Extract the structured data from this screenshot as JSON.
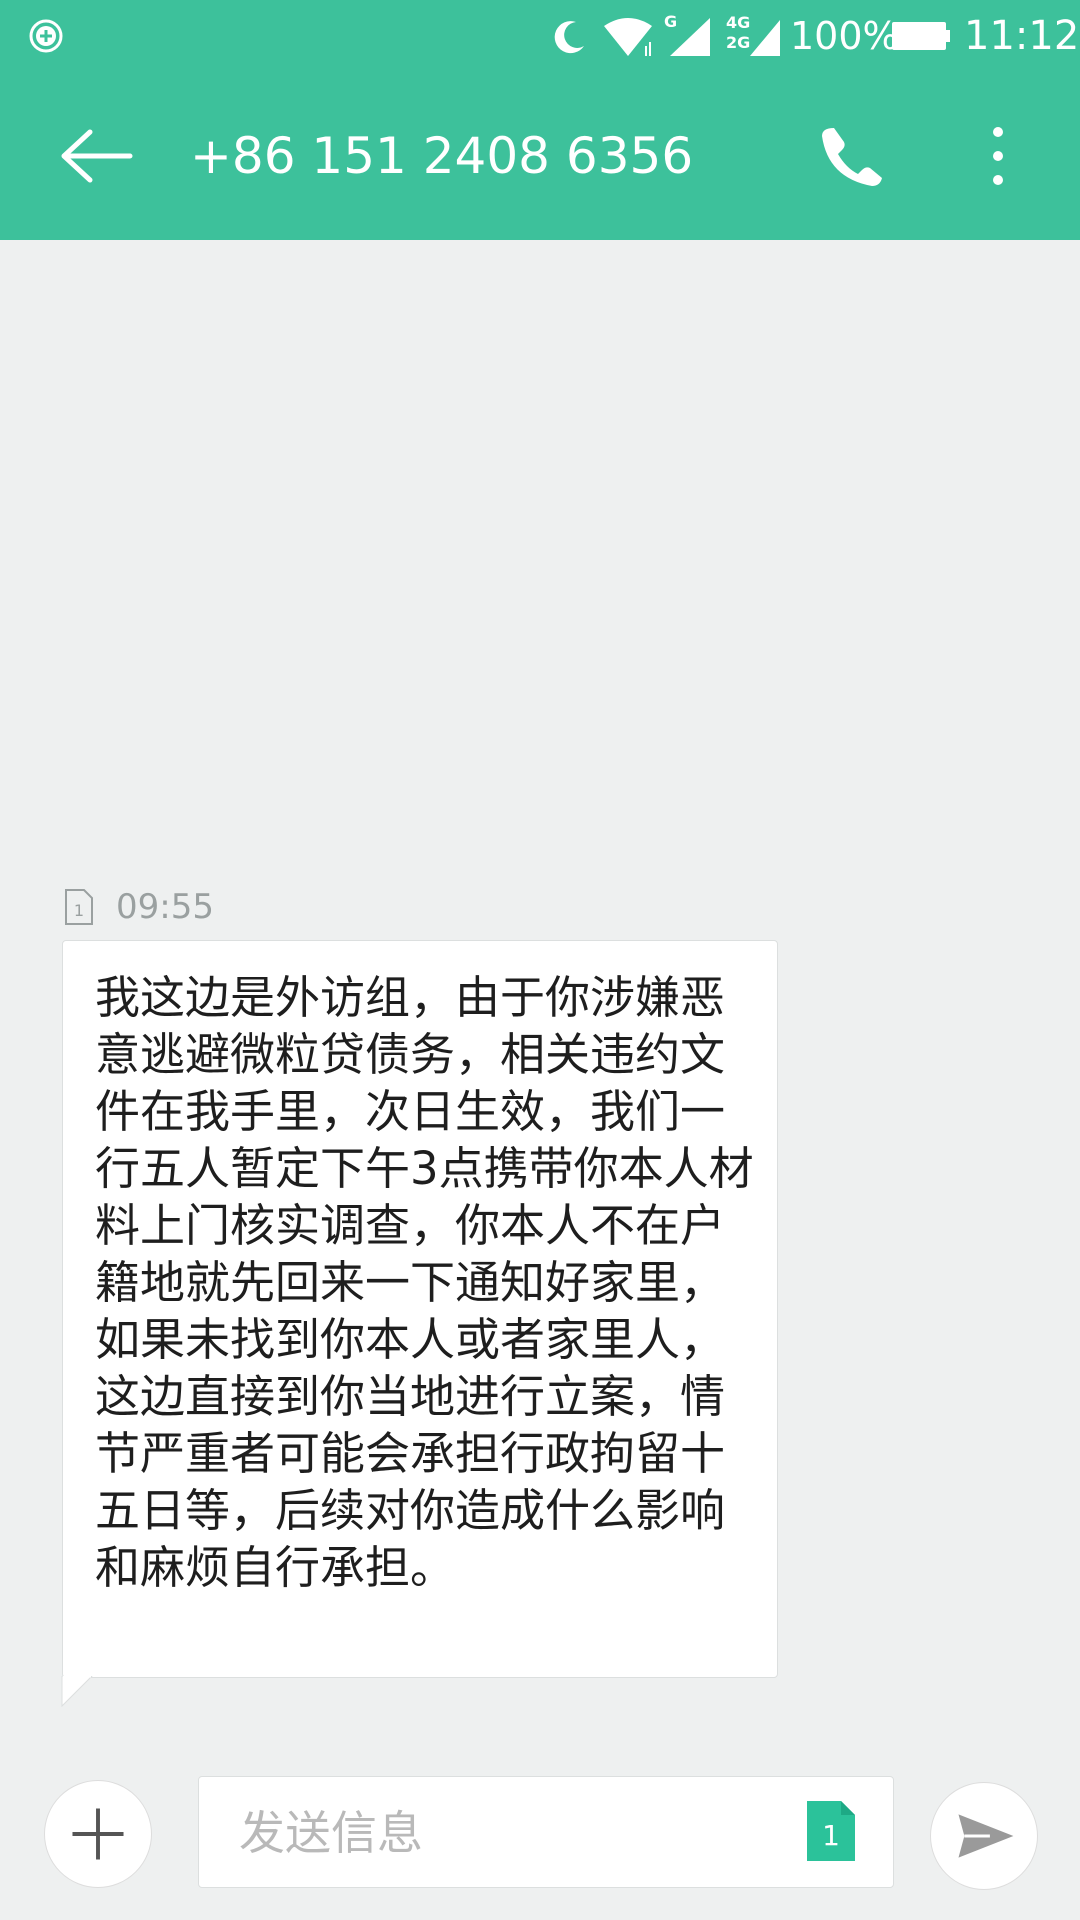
{
  "statusbar": {
    "battery": "100%",
    "time": "11:12",
    "network_labels": {
      "g": "G",
      "4g": "4G",
      "2g": "2G"
    },
    "icons": [
      "add-circle-icon",
      "moon-icon",
      "wifi-icon",
      "signal-icon",
      "battery-icon"
    ]
  },
  "header": {
    "title": "+86 151 2408 6356",
    "back_icon": "arrow-left-icon",
    "call_icon": "phone-icon",
    "more_icon": "more-vertical-icon"
  },
  "message": {
    "time": "09:55",
    "sim_slot": "1",
    "text": "我这边是外访组，由于你涉嫌恶意逃避微粒贷债务，相关违约文件在我手里，次日生效，我们一行五人暂定下午3点携带你本人材料上门核实调查，你本人不在户籍地就先回来一下通知好家里，如果未找到你本人或者家里人，这边直接到你当地进行立案，情节严重者可能会承担行政拘留十五日等，后续对你造成什么影响和麻烦自行承担。"
  },
  "composer": {
    "placeholder": "发送信息",
    "sim_badge": "1",
    "add_icon": "plus-icon",
    "send_icon": "send-icon"
  },
  "colors": {
    "accent": "#3dc19b",
    "background": "#eef0f0",
    "sim_badge": "#2bc29a"
  }
}
